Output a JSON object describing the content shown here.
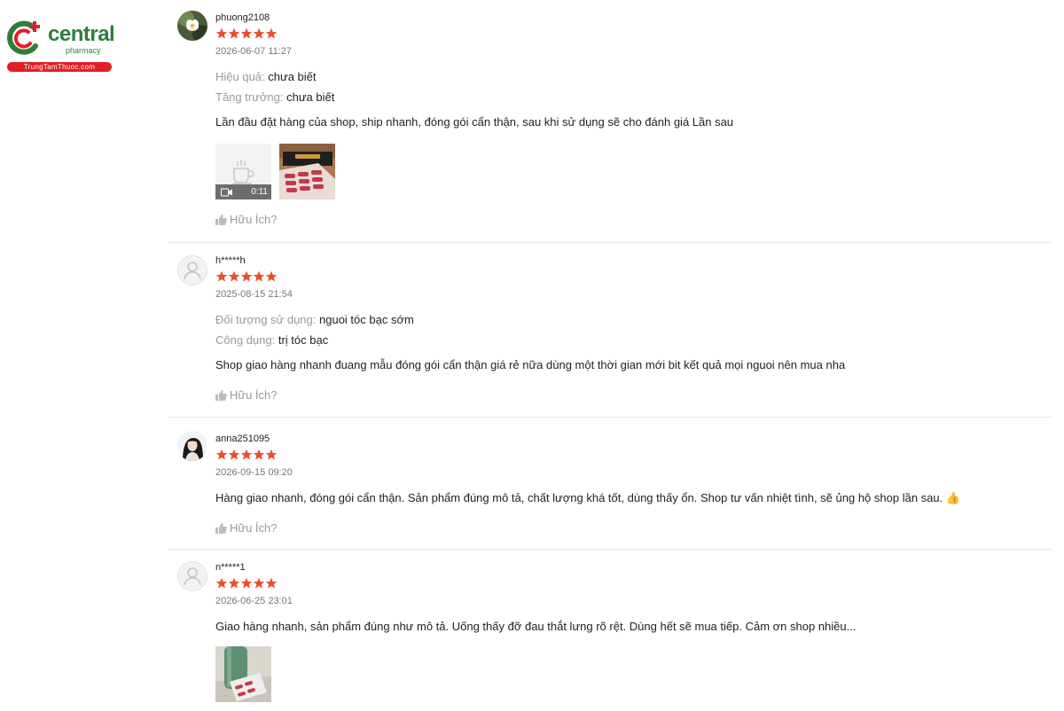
{
  "brand": {
    "name": "central",
    "subtitle": "pharmacy",
    "site": "TrungTamThuoc.com"
  },
  "colors": {
    "star": "#ee4d2d",
    "brand_green": "#2e7d3a",
    "brand_red": "#e31f26",
    "label_gray": "#999999"
  },
  "helpful_label": "Hữu Ích?",
  "reviews": [
    {
      "username": "phuong2108",
      "avatar": "flower-photo",
      "rating": 5,
      "date": "2026-06-07 11:27",
      "attributes": [
        {
          "label": "Hiệu quả:",
          "value": "chưa biết"
        },
        {
          "label": "Tăng trưởng:",
          "value": "chưa biết"
        }
      ],
      "comment": "Lần đầu đặt hàng của shop, ship nhanh, đóng gói cẩn thận, sau khi sử dụng sẽ cho đánh giá Lần sau",
      "media": [
        {
          "type": "video",
          "duration": "0:11"
        },
        {
          "type": "photo",
          "subject": "product-box-and-blister"
        }
      ]
    },
    {
      "username": "h*****h",
      "avatar": "default-user-icon",
      "rating": 5,
      "date": "2025-08-15 21:54",
      "attributes": [
        {
          "label": "Đối tượng sử dụng:",
          "value": "nguoi tóc bạc sớm"
        },
        {
          "label": "Công dụng:",
          "value": "trị tóc bạc"
        }
      ],
      "comment": "Shop giao hàng nhanh đuang mẫu đóng gói cẩn thận giá rẻ nữa dùng một thời gian mới bit kết quả mọi nguoi nên mua nha",
      "media": []
    },
    {
      "username": "anna251095",
      "avatar": "woman-photo",
      "rating": 5,
      "date": "2026-09-15 09:20",
      "attributes": [],
      "comment": "Hàng giao nhanh, đóng gói cẩn thận. Sản phẩm đúng mô tả, chất lượng khá tốt, dùng thấy ổn. Shop tư vấn nhiệt tình, sẽ ủng hộ shop lần sau. 👍",
      "media": []
    },
    {
      "username": "n*****1",
      "avatar": "default-user-icon",
      "rating": 5,
      "date": "2026-06-25 23:01",
      "attributes": [],
      "comment": "Giao hàng nhanh, sản phẩm đúng như mô tả. Uống thấy đỡ đau thắt lưng rõ rệt. Dùng hết sẽ mua tiếp. Cảm ơn shop nhiều...",
      "media": [
        {
          "type": "photo",
          "subject": "bottle-and-blister"
        }
      ]
    }
  ]
}
